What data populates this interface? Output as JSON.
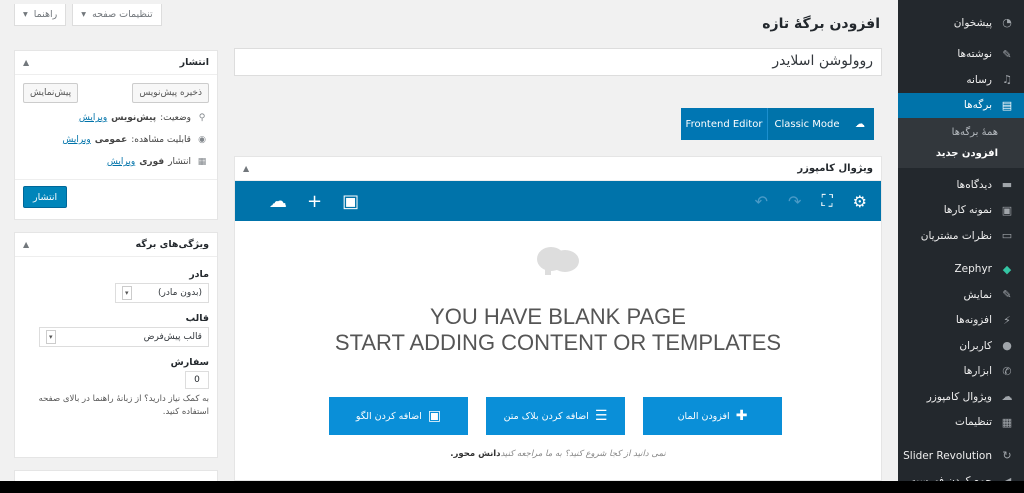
{
  "top_tabs": {
    "screen_options": "تنظیمات صفحه",
    "help": "راهنما"
  },
  "page_heading": "افزودن برگهٔ تازه",
  "title_value": "روولوشن اسلایدر",
  "mode_buttons": {
    "frontend_editor": "Frontend Editor",
    "classic_mode": "Classic Mode"
  },
  "composer": {
    "heading": "ویژوال کامپوزر",
    "blank_line1": "YOU HAVE BLANK PAGE",
    "blank_line2": "START ADDING CONTENT OR TEMPLATES",
    "buttons": {
      "add_element": "افزودن المان",
      "add_text_block": "اضافه کردن بلاک متن",
      "add_template": "اضافه کردن الگو"
    },
    "help_prefix": "نمی دانید از کجا شروع کنید؟ به ما مراجعه کنید",
    "help_link": "دانش محور."
  },
  "publish": {
    "heading": "انتشار",
    "save_draft": "ذخیره پیش‌نویس",
    "preview": "پیش‌نمایش",
    "status_label": "وضعیت:",
    "status_value": "پیش‌نویس",
    "visibility_label": "قابلیت مشاهده:",
    "visibility_value": "عمومی",
    "publish_label": "انتشار",
    "publish_value": "فوری",
    "edit": "ویرایش",
    "publish_button": "انتشار"
  },
  "attributes": {
    "heading": "ویژگی‌های برگه",
    "parent_label": "مادر",
    "parent_value": "(بدون مادر)",
    "template_label": "قالب",
    "template_value": "قالب پیش‌فرض",
    "order_label": "سفارش",
    "order_value": "0",
    "help_text": "به کمک نیاز دارید؟ از زبانهٔ راهنما در بالای صفحه استفاده کنید."
  },
  "admin_menu": {
    "items": [
      {
        "label": "پیشخوان",
        "icon": "dashboard-icon"
      },
      {
        "label": "نوشته‌ها",
        "icon": "pin-icon"
      },
      {
        "label": "رسانه",
        "icon": "media-icon"
      },
      {
        "label": "برگه‌ها",
        "icon": "pages-icon"
      }
    ],
    "submenu": [
      "همهٔ برگه‌ها",
      "افزودن جدید"
    ],
    "items2": [
      {
        "label": "دیدگاه‌ها",
        "icon": "comments-icon"
      },
      {
        "label": "نمونه کارها",
        "icon": "portfolio-icon"
      },
      {
        "label": "نظرات مشتریان",
        "icon": "testimonials-icon"
      },
      {
        "label": "Zephyr",
        "icon": "diamond-icon"
      },
      {
        "label": "نمایش",
        "icon": "appearance-icon"
      },
      {
        "label": "افزونه‌ها",
        "icon": "plugins-icon"
      },
      {
        "label": "کاربران",
        "icon": "users-icon"
      },
      {
        "label": "ابزارها",
        "icon": "tools-icon"
      },
      {
        "label": "ویژوال کامپوزر",
        "icon": "vc-icon"
      },
      {
        "label": "تنظیمات",
        "icon": "settings-icon"
      },
      {
        "label": "Slider Revolution",
        "icon": "refresh-icon"
      },
      {
        "label": "جمع کردن فهرست",
        "icon": "collapse-icon"
      }
    ]
  }
}
